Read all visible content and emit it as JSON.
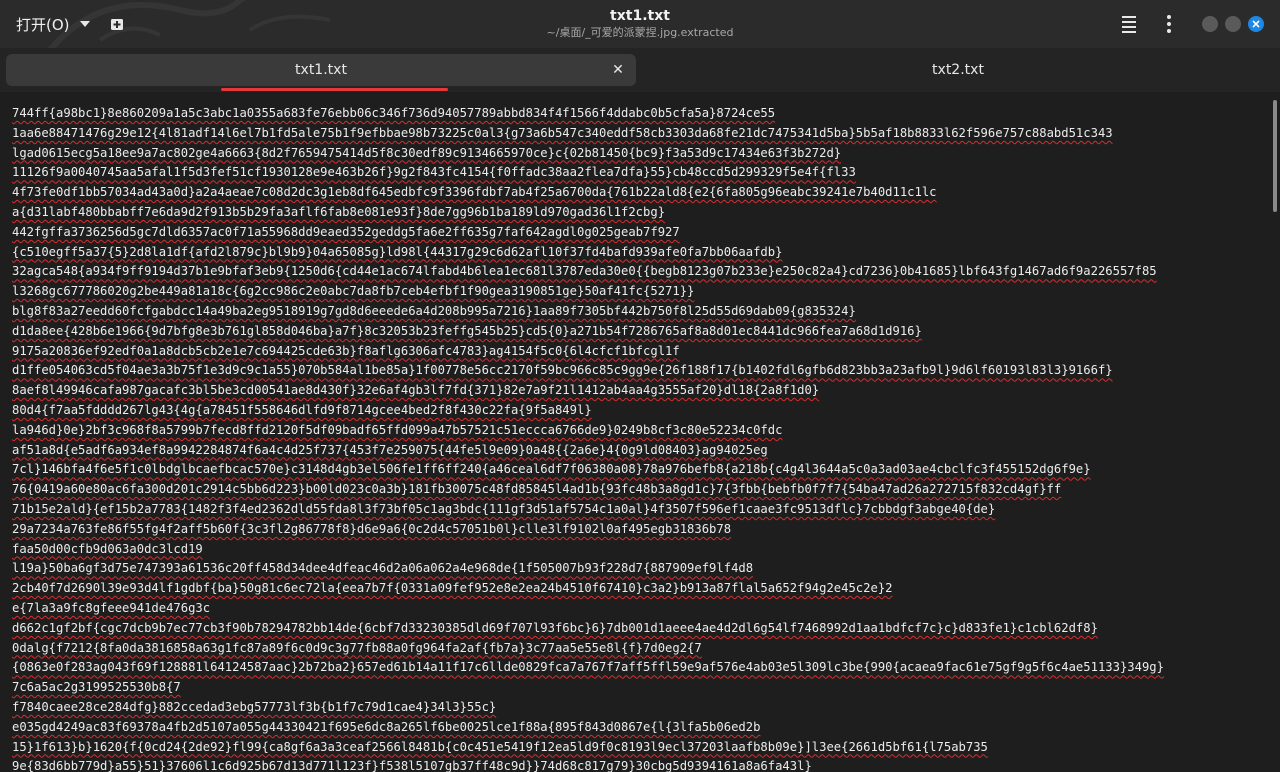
{
  "header": {
    "open_label": "打开(O)",
    "title": "txt1.txt",
    "subtitle": "~/桌面/_可爱的派蒙捏.jpg.extracted"
  },
  "tabs": [
    {
      "label": "txt1.txt",
      "active": true
    },
    {
      "label": "txt2.txt",
      "active": false
    }
  ],
  "colors": {
    "accent": "#e53935",
    "close_button": "#1e88e5",
    "spellcheck_underline": "#d32f2f"
  },
  "editor": {
    "lines": [
      "744ff{a98bc1}8e860209a1a5c3abc1a0355a683fe76ebb06c346f736d94057789abbd834f4f1566f4ddabc0b5cfa5a}8724ce55",
      "1aa6e88471476g29e12{4l81adf14l6el7b1fd5ale75b1f9efbbae98b73225c0al3{g73a6b547c340eddf58cb3303da68fe21dc7475341d5ba}5b5af18b8833l62f596e757c88abd51c343",
      "lgad0615ecg5a18ee9a7ac802ge4a6663{8d2f7659475414d5f8c30edf89c9134665970ce}c{02b81450{bc9}f3a53d9c17434e63f3b272d}",
      "11126f9a0040745aa5afal1f5d3fef51cf1930128e9e463b26f}9g2f843fc4154{f0ffadc38aa2flea7dfa}55}cb48ccd5d299329f5e4f{fl33",
      "4f73fe0df1bb57034ad43a0d}a2a4aeae7c08d2dc3g1eb8df645edbfc9f3396fdbf7ab4f25a6700da{761b22ald8{e2{6fa805g96eabc39241e7b40d11c1lc",
      "a{d31labf480bbabff7e6da9d2f913b5b29fa3aflf6fab8e081e93f}8de7gg96b1ba189ld970gad36l1f2cbg}",
      "442fgffa3736256d5gc7dld6357ac0f71a55968dd9eaed352geddg5fa6e2ff635g7faf642agdl0g025geab7f927",
      "{c510egff5a37{5}2d8la1df{afd2l879c}bl9b9}04a65085g}ld98l{44317g29c6d62afl10f37fd4bafd939afe0fa7bb06aafdb}",
      "32agca548{a934f9ff9194d37b1e9bfaf3eb9{1250d6{cd44e1ac674lfabd4b6lea1ec681l3787eda30e0{{begb8123g07b233e}e250c82a4}cd7236}0b41685}lbf643fg1467ad6f9a226557f85",
      "l3268gc677786020g2be449a81a18c{6g2cc986c2e0abc7da8fb7ceb4efbf1f90gea3190851ge}50af41fc{5271}}",
      "blg8f83a27eedd60fcfgabdcc14a49ba2eg9518919g7gd8d6eeede6a4d208b995a7216}1aa89f7305bf442b750f8l25d55d69dab09{g835324}",
      "d1da8ee{428b6e1966{9d7bfg8e3b761gl858d046ba}a7f}8c32053b23feffg545b25}cd5{0}a271b54f7286765af8a8d01ec8441dc966fea7a68d1d916}",
      "9175a20836ef92edf0a1a8dcb5cb2e1e7c694425cde63b}f8aflg6306afc4783}ag4154f5c0{6l4cfcf1bfcgl1f",
      "d1ffe054063cd5f04ae3a3b75f1e3d9c9c1a55}070b584al1be85a}1f00778e56cc2170f59bc966c85c9gg9e{26f188f17{b1402fdl6gfb6d823bb3a23afb9l}9d6lf60193l83l3}9166f}",
      "8aef8l49946cafa987gacafc3bl5be3cd00541ae8d430f}32e6af4gb3lf7fd{371}82e7a9f21l1412ab4aa4g3555af20}dl18{2a8f1d0}",
      "80d4{f7aa5fdddd267lg43{4g{a78451f558646dlfd9f8714gcee4bed2f8f430c22fa{9f5a849l}",
      "la946d}0e}2bf3c968f8a5799b7fecd8ffd2120f5df09badf65ffd099a47b57521c51eccca6766de9}0249b8cf3c80e52234c0fdc",
      "af51a8d{e5adf6a934ef8a9942284874f6a4c4d25f737{453f7e259075{44fe5l9e09}0a48{{2a6e}4{0g9ld08403}ag94025eg",
      "7cl}146bfa4f6e5f1c0lbdglbcaefbcac570e}c3148d4gb3el506fe1ff6ff240{a46ceal6df7f06380a08}78a976befb8{a218b{c4g4l3644a5c0a3ad03ae4cbclfc3f455152dg6f9e}",
      "76{0419a60e80ac6fa300d201c2914c5bb6d223}b00ld023c0a3b}181fb30075c48fd85845l4ad1b{93fc48b3a8gd1c}7{3fbb{bebfb0f7f7{54ba47ad26a272715f832cd4gf}ff",
      "71b15e2ald}{ef15b2a7783{1482f3f4ed2362dld55fda8l3f73bf05c1ag3bdc{111gf3d51af5754c1a0al}4f3507f596ef1caae3fc9513dflc}7cbbdgf3abge40{de}",
      "29a7234a763fe86f55fg4f2aff5b60f{3c3fl2g86778f8}d6e9a6{0c2d4c57051b0l}clle3lf9102l0af495egb31836b78",
      "faa50d00cfb9d063a0dc3lcd19",
      "l19a}50ba6gf3d75e747393a61536c20ff458d34dee4dfeac46d2a06a062a4e968de{1f505007b93f228d7{887909ef9lf4d8",
      "2cb40f7d2690l39e93d4lf1gdbf{ba}50g81c6ec72la{eea7b7f{0331a09fef952e8e2ea24b4510f67410}c3a2}b913a87flal5a652f94g2e45c2e}2",
      "e{7la3a9fc8gfeee941de476g3c",
      "d662c1gf2bf{cgc7dcb9b7ec77cb3f90b78294782bb14de{6cbf7d33230385dld69f707l93f6bc}6}7db001d1aeee4ae4d2dl6g54lf7468992d1aa1bdfcf7c}c}d833fe1}c1cbl62df8}",
      "0dalg{f7212{8fa0da3816858a63g1fc87a89f6c0d9c3g77fb88a0fg964fa2af{fb7a}3c77aa5e55e8l{f}7d0eg2{7",
      "{0863e0f283ag043f69f128881l64124587aac}2b72ba2}657ed61b14a11f17c6llde0829fca7a767f7aff5ffl59e9af576e4ab03e5l309lc3be{990{acaea9fac61e75gf9g5f6c4ae51133}349g}",
      "7c6a5ac2g3199525530b8{7",
      "f7840caee28ce284dfg}882ccedad3ebg57773lf3b{b1f7c79d1cae4}34l3}55c}",
      "e035gd4249ac83f69378a4fb2d5107a055g44330421f695e6dc8a265lf6be0025lce1f88a{895f843d0867e{l{3lfa5b06ed2b",
      "15}1f613}b}1620{f{0cd24{2de92}fl99{ca8gf6a3a3ceaf2566l8481b{c0c451e5419f12ea5ld9f0c8193l9ecl37203laafb8b09e}]l3ee{2661d5bf61{l75ab735",
      "9e{83d6bb779d}a55}51}37606l1c6d925b67d13d771l123f}f538l5107gb37ff48c9d}}74d68c817g79}30cbg5d9394161a8a6fa43l}"
    ]
  }
}
